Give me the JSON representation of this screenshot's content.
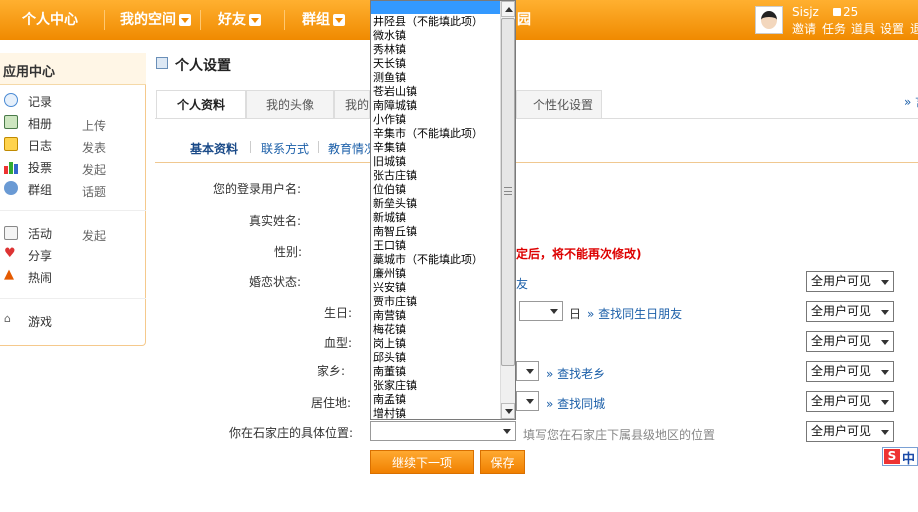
{
  "topnav": {
    "items": [
      "个人中心",
      "我的空间",
      "好友",
      "群组"
    ],
    "partial_item": "园",
    "username": "Sisjz",
    "credits": "25",
    "links": [
      "邀请",
      "任务",
      "道具",
      "设置",
      "退"
    ]
  },
  "sidebar": {
    "title": "应用中心",
    "items": [
      {
        "label": "记录",
        "action": ""
      },
      {
        "label": "相册",
        "action": "上传"
      },
      {
        "label": "日志",
        "action": "发表"
      },
      {
        "label": "投票",
        "action": "发起"
      },
      {
        "label": "群组",
        "action": "话题"
      },
      {
        "label": "活动",
        "action": "发起"
      },
      {
        "label": "分享",
        "action": ""
      },
      {
        "label": "热闹",
        "action": ""
      },
      {
        "label": "游戏",
        "action": ""
      }
    ]
  },
  "main": {
    "title": "个人设置",
    "tabs": [
      "个人资料",
      "我的头像",
      "我的",
      "个性化设置"
    ],
    "more": "» 言",
    "subtabs": [
      "基本资料",
      "联系方式",
      "教育情况"
    ],
    "labels": {
      "username": "您的登录用户名:",
      "realname": "真实姓名:",
      "gender": "性别:",
      "marital": "婚恋状态:",
      "birthday": "生日:",
      "blood": "血型:",
      "hometown": "家乡:",
      "residence": "居住地:",
      "location": "你在石家庄的具体位置:"
    },
    "gender_warning": "定后，将不能再次修改)",
    "marital_link": "友",
    "day_label": "日",
    "find_birthday": "» 查找同生日朋友",
    "find_hometown": "» 查找老乡",
    "find_residence": "» 查找同城",
    "location_hint": "填写您在石家庄下属县级地区的位置",
    "visibility": "全用户可见",
    "next_button": "继续下一项",
    "save_button": "保存"
  },
  "dropdown": {
    "options": [
      "井陉县（不能填此项）",
      "微水镇",
      "秀林镇",
      "天长镇",
      "测鱼镇",
      "苍岩山镇",
      "南障城镇",
      "小作镇",
      "辛集市（不能填此项）",
      "辛集镇",
      "旧城镇",
      "张古庄镇",
      "位伯镇",
      "新垒头镇",
      "新城镇",
      "南智丘镇",
      "王口镇",
      "藁城市（不能填此项）",
      "廉州镇",
      "兴安镇",
      "贾市庄镇",
      "南营镇",
      "梅花镇",
      "岗上镇",
      "邱头镇",
      "南董镇",
      "张家庄镇",
      "南孟镇",
      "增村镇"
    ]
  },
  "ime": {
    "s": "S",
    "text": "中"
  }
}
